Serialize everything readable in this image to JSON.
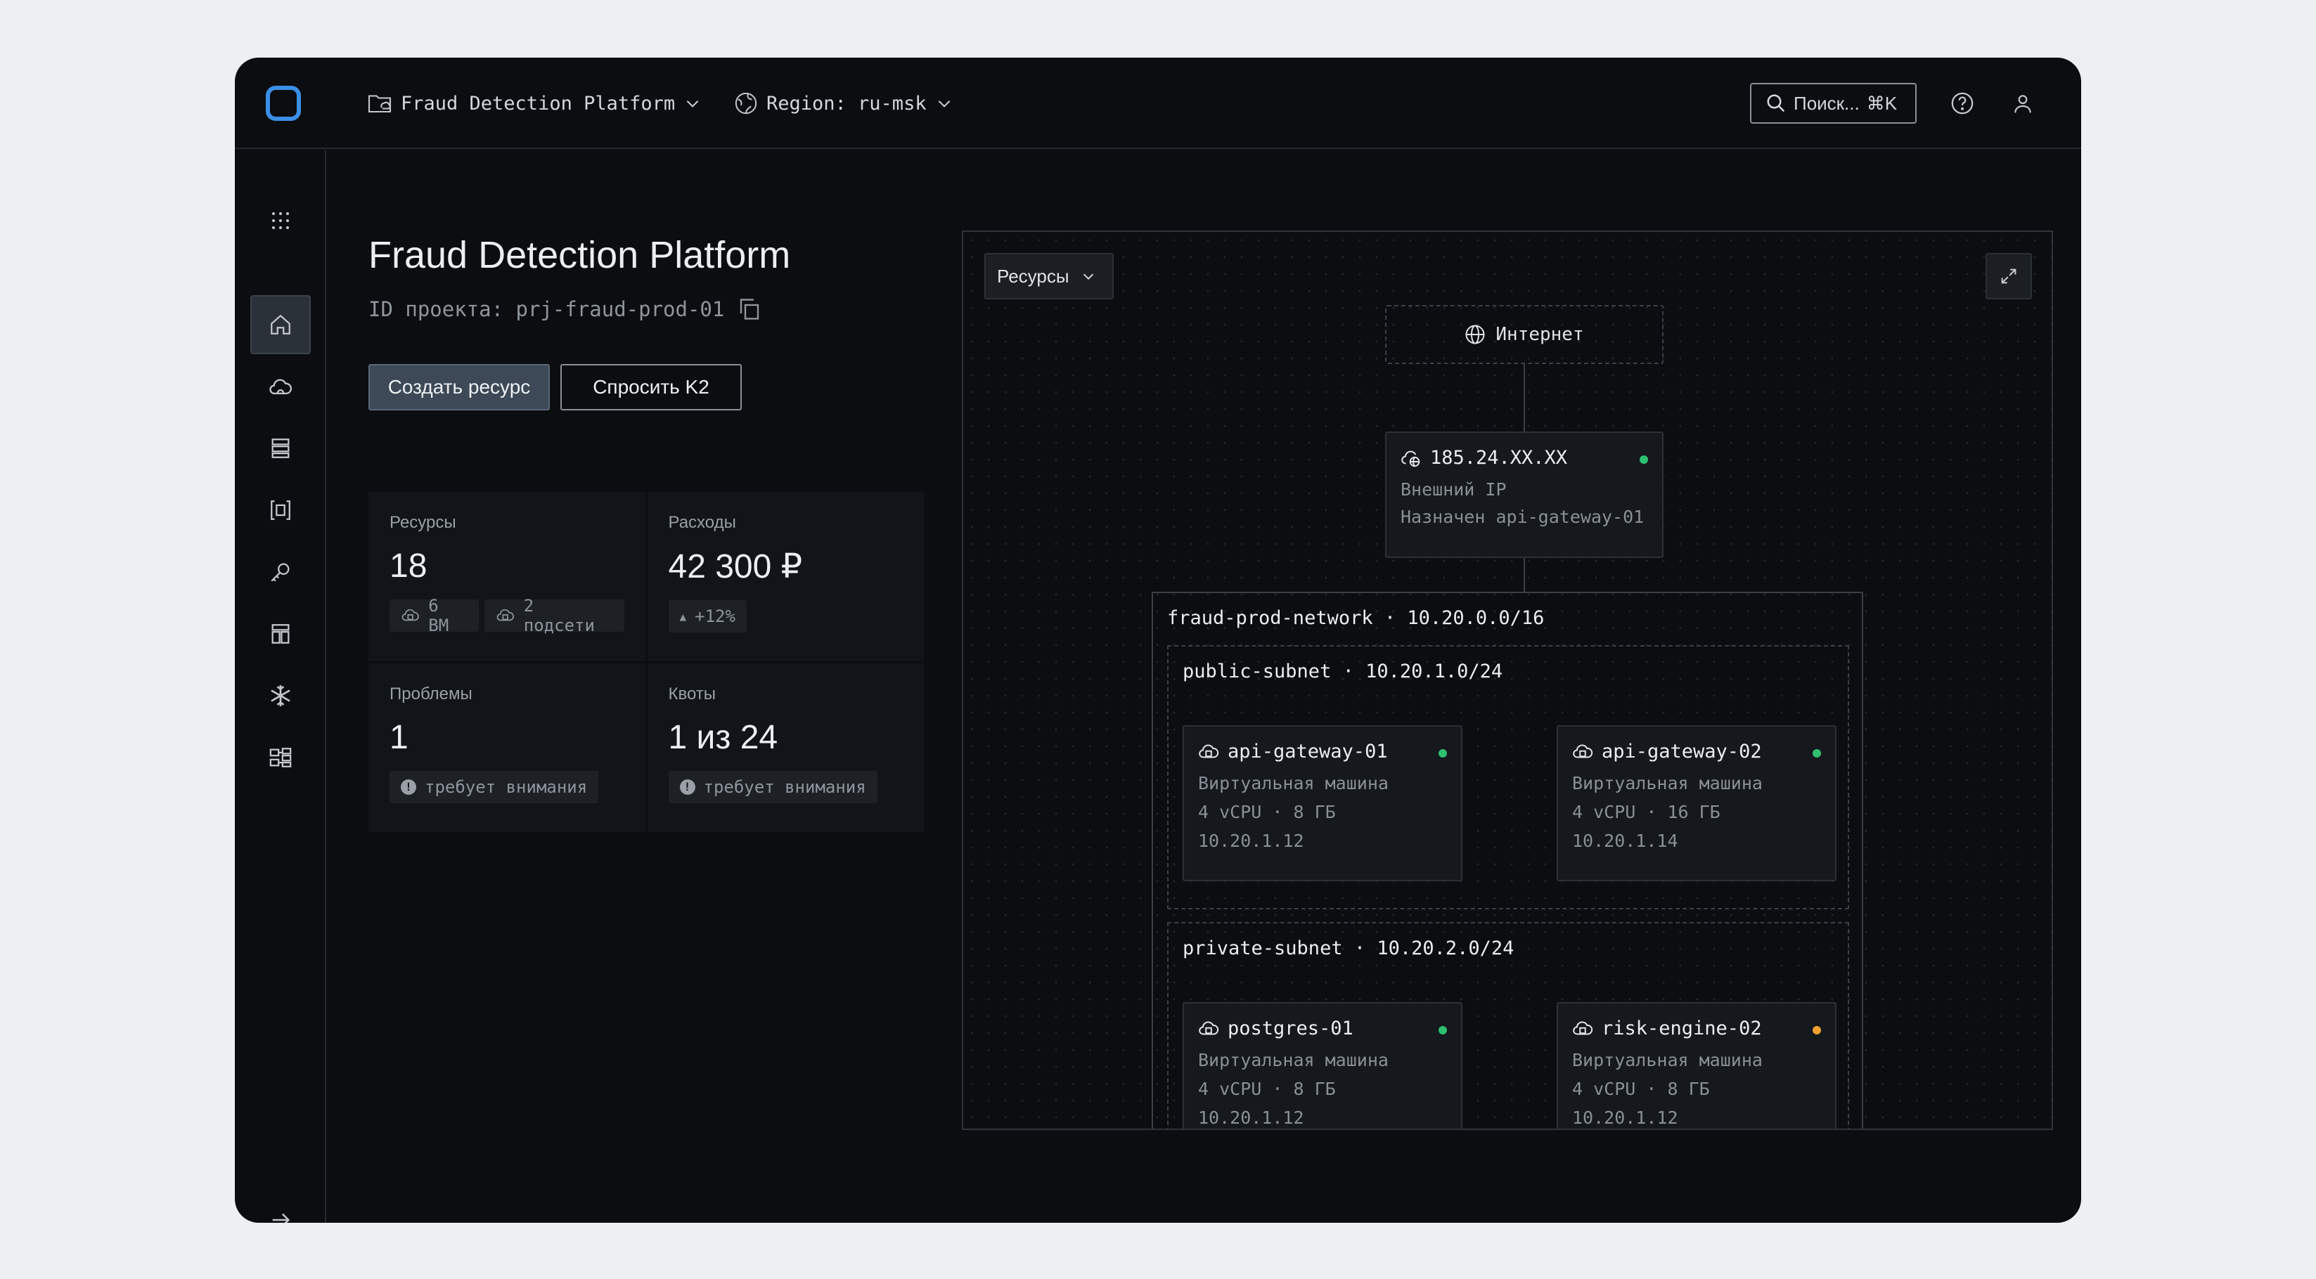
{
  "topbar": {
    "project_name": "Fraud Detection Platform",
    "region_label": "Region: ru-msk",
    "search_placeholder": "Поиск...",
    "search_shortcut": "⌘K"
  },
  "sidebar": {
    "items": [
      {
        "icon": "apps-grid-icon"
      },
      {
        "icon": "home-icon",
        "active": true
      },
      {
        "icon": "cloud-icon"
      },
      {
        "icon": "storage-icon"
      },
      {
        "icon": "container-icon"
      },
      {
        "icon": "key-icon"
      },
      {
        "icon": "layout-icon"
      },
      {
        "icon": "snowflake-icon"
      },
      {
        "icon": "network-icon"
      }
    ],
    "collapse_icon": "arrow-right-icon"
  },
  "main": {
    "title": "Fraud Detection Platform",
    "project_id_label": "ID проекта: prj-fraud-prod-01",
    "create_button": "Создать ресурс",
    "ask_button": "Спросить K2",
    "stats": {
      "resources": {
        "label": "Ресурсы",
        "value": "18",
        "chip_vm": "6 ВМ",
        "chip_subnets": "2 подсети"
      },
      "costs": {
        "label": "Расходы",
        "value": "42 300 ₽",
        "chip_trend": "+12%"
      },
      "problems": {
        "label": "Проблемы",
        "value": "1",
        "chip_attention": "требует внимания"
      },
      "quotas": {
        "label": "Квоты",
        "value": "1 из 24",
        "chip_attention": "требует внимания"
      }
    }
  },
  "diagram": {
    "dropdown_label": "Ресурсы",
    "internet_label": "Интернет",
    "ip_node": {
      "title": "185.24.XX.XX",
      "type": "Внешний IP",
      "assigned": "Назначен api-gateway-01",
      "status_color": "#2fbf71"
    },
    "network_label": "fraud-prod-network · 10.20.0.0/16",
    "public_subnet_label": "public-subnet · 10.20.1.0/24",
    "private_subnet_label": "private-subnet · 10.20.2.0/24",
    "nodes": [
      {
        "name": "api-gateway-01",
        "type": "Виртуальная машина",
        "spec": "4 vCPU · 8 ГБ",
        "ip": "10.20.1.12",
        "status_color": "#2fbf71"
      },
      {
        "name": "api-gateway-02",
        "type": "Виртуальная машина",
        "spec": "4 vCPU · 16 ГБ",
        "ip": "10.20.1.14",
        "status_color": "#2fbf71"
      },
      {
        "name": "postgres-01",
        "type": "Виртуальная машина",
        "spec": "4 vCPU · 8 ГБ",
        "ip": "10.20.1.12",
        "status_color": "#2fbf71"
      },
      {
        "name": "risk-engine-02",
        "type": "Виртуальная машина",
        "spec": "4 vCPU · 8 ГБ",
        "ip": "10.20.1.12",
        "status_color": "#f0a030"
      }
    ]
  }
}
